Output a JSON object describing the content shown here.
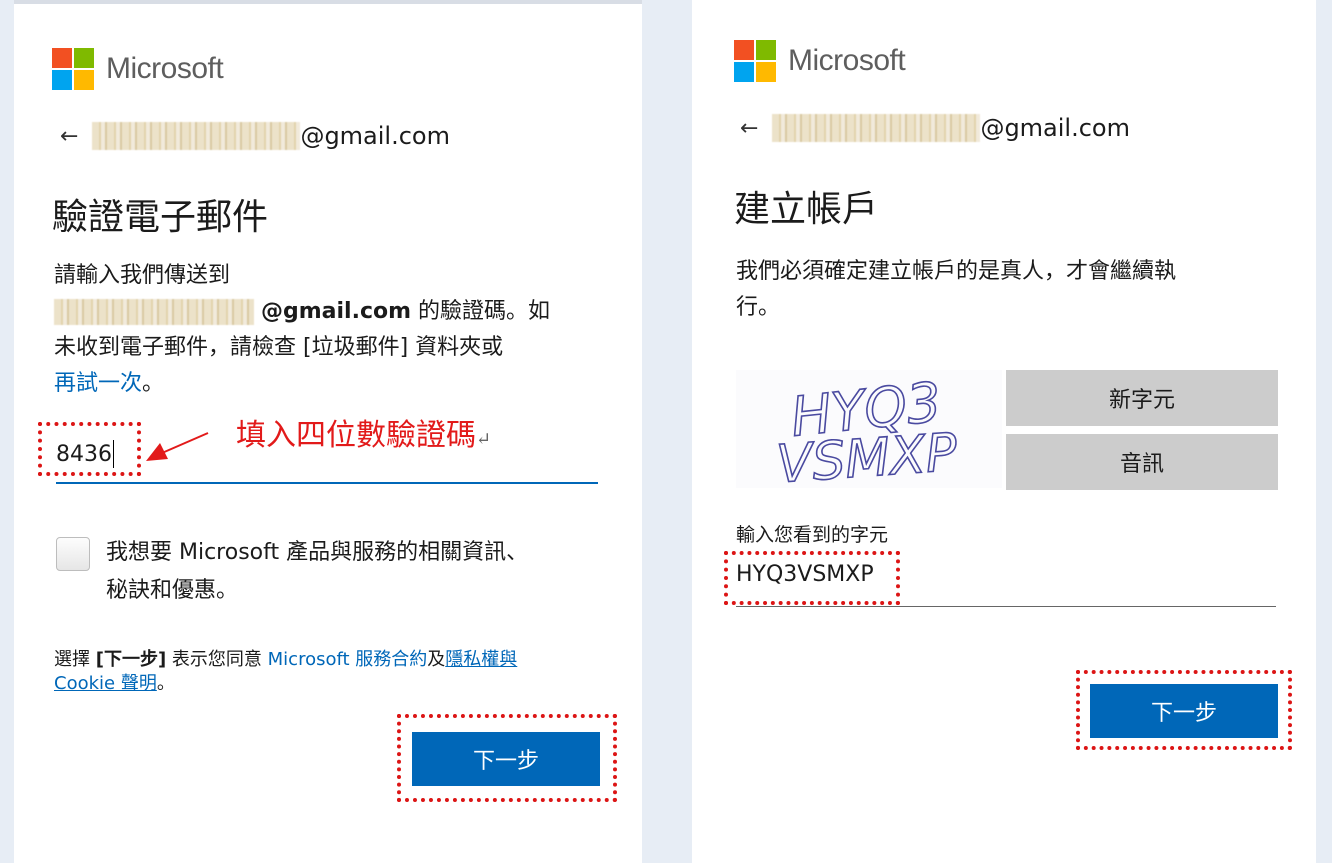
{
  "left": {
    "brand": "Microsoft",
    "logo_colors": {
      "red": "#f25022",
      "green": "#7fba00",
      "blue": "#00a4ef",
      "yellow": "#ffb900"
    },
    "identity": {
      "back_arrow": "←",
      "email_suffix": "@gmail.com"
    },
    "title": "驗證電子郵件",
    "desc": {
      "line1": "請輸入我們傳送到",
      "email_bold": "@gmail.com",
      "line2_rest": " 的驗證碼。如",
      "line3": "未收到電子郵件，請檢查 [垃圾郵件] 資料夾或",
      "retry_link": "再試一次",
      "retry_end": "。"
    },
    "code_value": "8436",
    "checkbox": {
      "line1": "我想要 Microsoft 產品與服務的相關資訊、",
      "line2": "秘訣和優惠。"
    },
    "terms": {
      "prefix": "選擇 ",
      "next_bold": "[下一步]",
      "middle": " 表示您同意 ",
      "service_link": "Microsoft 服務合約",
      "and": "及",
      "privacy_link_1": "隱私權與",
      "privacy_link_2": "Cookie 聲明",
      "end": "。"
    },
    "next_button": "下一步"
  },
  "annotation": {
    "text": "填入四位數驗證碼",
    "return_mark": "↵",
    "color": "#e21a1a"
  },
  "right": {
    "brand": "Microsoft",
    "identity": {
      "back_arrow": "←",
      "email_suffix": "@gmail.com"
    },
    "title": "建立帳戶",
    "desc": {
      "line1": "我們必須確定建立帳戶的是真人，才會繼續執",
      "line2": "行。"
    },
    "captcha": {
      "row1": "HYQ3",
      "row2": "VSMXP",
      "new_chars_button": "新字元",
      "audio_button": "音訊"
    },
    "input_label": "輸入您看到的字元",
    "input_value": "HYQ3VSMXP",
    "next_button": "下一步"
  }
}
